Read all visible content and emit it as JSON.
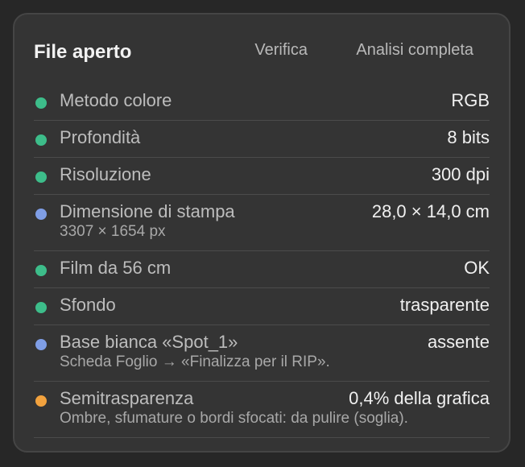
{
  "panel": {
    "title": "File aperto",
    "actions": {
      "verify_label": "Verifica",
      "full_analysis_label": "Analisi completa"
    }
  },
  "colors": {
    "ok": "#3dbd8a",
    "info": "#7f9ee6",
    "warning": "#f2a23e"
  },
  "rows": [
    {
      "label": "Metodo colore",
      "value": "RGB",
      "status": "ok"
    },
    {
      "label": "Profondità",
      "value": "8 bits",
      "status": "ok"
    },
    {
      "label": "Risoluzione",
      "value": "300 dpi",
      "status": "ok"
    },
    {
      "label": "Dimensione di stampa",
      "value": "28,0 × 14,0 cm",
      "note": "3307 × 1654 px",
      "status": "info"
    },
    {
      "label": "Film da 56 cm",
      "value": "OK",
      "status": "ok"
    },
    {
      "label": "Sfondo",
      "value": "trasparente",
      "status": "ok"
    },
    {
      "label": "Base bianca «Spot_1»",
      "value": "assente",
      "note": "Scheda Foglio → «Finalizza per il RIP».",
      "status": "info"
    },
    {
      "label": "Semitrasparenza",
      "value": "0,4% della grafica",
      "note": "Ombre, sfumature o bordi sfocati: da pulire (soglia).",
      "status": "warning"
    }
  ]
}
